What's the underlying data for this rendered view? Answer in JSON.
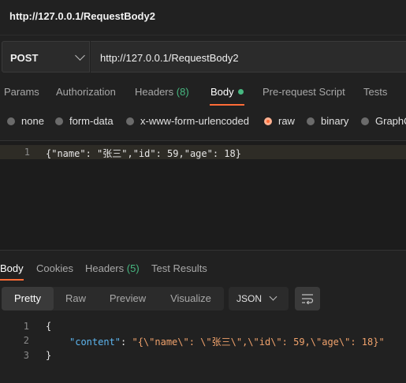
{
  "titlebar": {
    "title": "http://127.0.0.1/RequestBody2"
  },
  "request": {
    "method": "POST",
    "url": "http://127.0.0.1/RequestBody2"
  },
  "request_tabs": {
    "params": "Params",
    "authorization": "Authorization",
    "headers_label": "Headers",
    "headers_count": "(8)",
    "body": "Body",
    "prerequest": "Pre-request Script",
    "tests": "Tests"
  },
  "body_modes": {
    "none": "none",
    "form_data": "form-data",
    "urlencoded": "x-www-form-urlencoded",
    "raw": "raw",
    "binary": "binary",
    "graphql": "GraphQ"
  },
  "editor": {
    "line1_no": "1",
    "line1": "{\"name\": \"张三\",\"id\": 59,\"age\": 18}"
  },
  "response_tabs": {
    "body": "Body",
    "cookies": "Cookies",
    "headers_label": "Headers",
    "headers_count": "(5)",
    "test_results": "Test Results"
  },
  "response_view": {
    "pretty": "Pretty",
    "raw": "Raw",
    "preview": "Preview",
    "visualize": "Visualize",
    "format": "JSON"
  },
  "response_body": {
    "ln1": "1",
    "ln2": "2",
    "ln3": "3",
    "open": "{",
    "key": "\"content\"",
    "colon": ": ",
    "value": "\"{\\\"name\\\": \\\"张三\\\",\\\"id\\\": 59,\\\"age\\\": 18}\"",
    "close": "}"
  },
  "colors": {
    "accent": "#ff6c37",
    "count_green": "#47b881",
    "json_key": "#5db6f0",
    "json_string": "#f0a26c"
  }
}
